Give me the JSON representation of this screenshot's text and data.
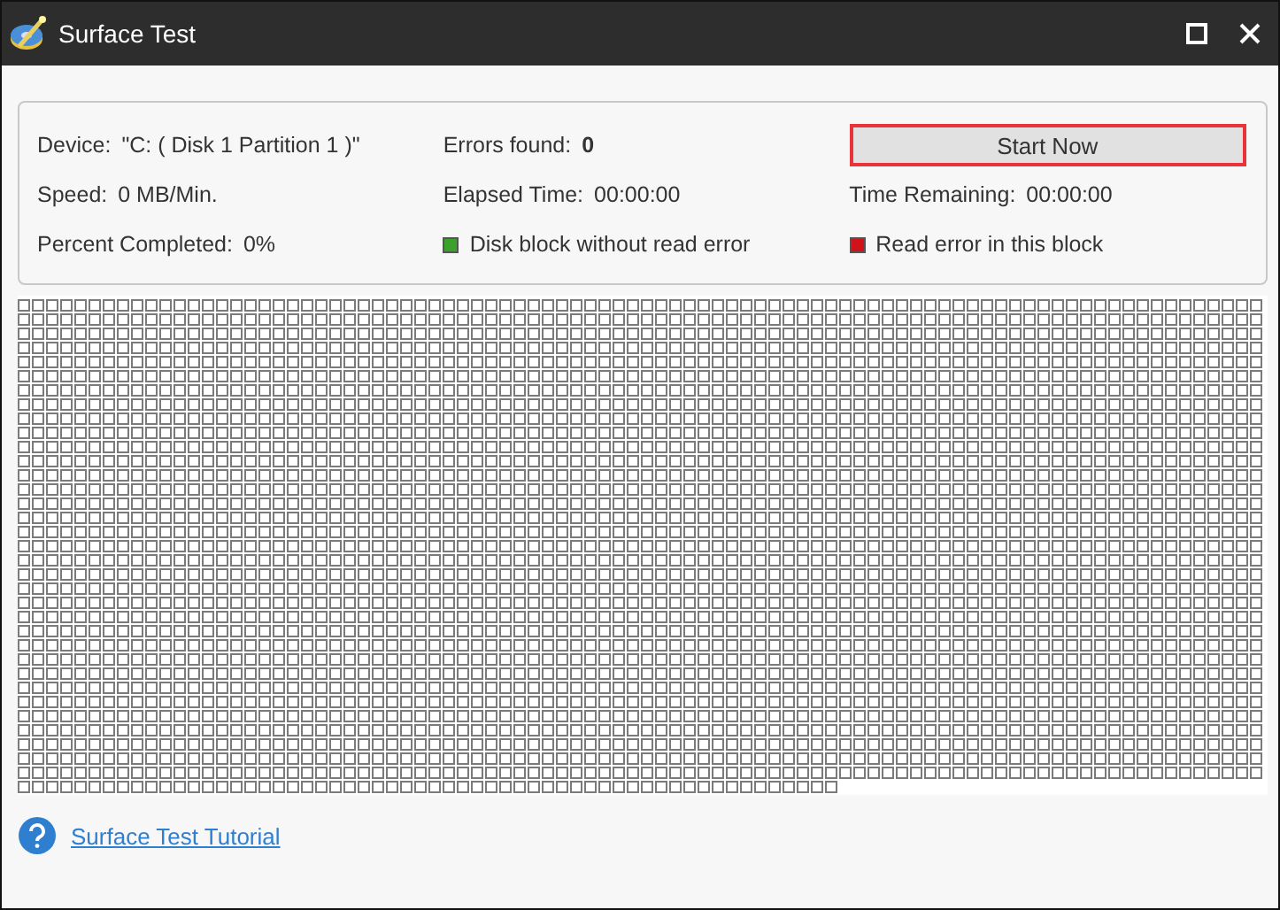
{
  "window": {
    "title": "Surface Test",
    "controls": [
      {
        "kind": "maximize"
      },
      {
        "kind": "close"
      }
    ]
  },
  "info": {
    "rows": [
      [
        {
          "label": "Device:",
          "value": "\"C: ( Disk 1 Partition 1 )\""
        },
        {
          "label": "Errors found:",
          "value": "0",
          "bold": true
        },
        {
          "kind": "button",
          "label": "Start Now",
          "highlighted": true
        }
      ],
      [
        {
          "label": "Speed:",
          "value": "0 MB/Min."
        },
        {
          "label": "Elapsed Time:",
          "value": "00:00:00"
        },
        {
          "label": "Time Remaining:",
          "value": "00:00:00"
        }
      ],
      [
        {
          "label": "Percent Completed:",
          "value": "0%"
        },
        {
          "kind": "legend",
          "label": "Disk block without read error",
          "color": "#3aa12a"
        },
        {
          "kind": "legend",
          "label": "Read error in this block",
          "color": "#d0121b"
        }
      ]
    ]
  },
  "footer": {
    "link": "Surface Test Tutorial"
  }
}
